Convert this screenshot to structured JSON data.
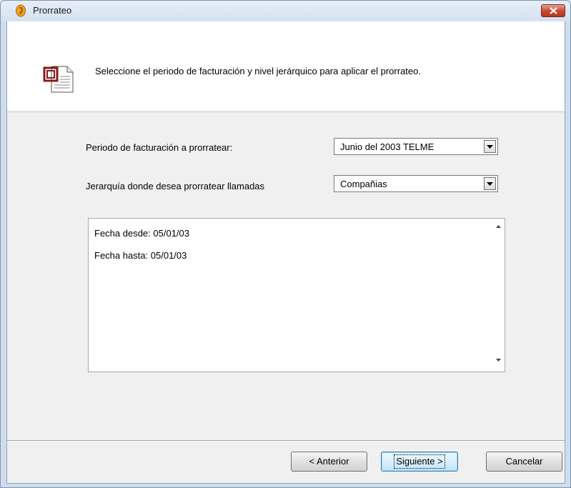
{
  "window": {
    "title": "Prorrateo",
    "app_icon": "ear-icon",
    "close_icon": "close-icon"
  },
  "header": {
    "icon": "document-icon",
    "instruction": "Seleccione el periodo de facturación y nivel jerárquico para aplicar el prorrateo."
  },
  "form": {
    "period_label": "Periodo de facturación a prorratear:",
    "period_value": "Junio del 2003 TELME",
    "hierarchy_label": "Jerarquía donde desea prorratear llamadas",
    "hierarchy_value": "Compañias"
  },
  "details": {
    "line1": "Fecha desde: 05/01/03",
    "line2": "Fecha hasta: 05/01/03"
  },
  "buttons": {
    "back": "< Anterior",
    "next": "Siguiente >",
    "cancel": "Cancelar"
  },
  "colors": {
    "close_button": "#c7472f",
    "window_border": "#7f95b3"
  }
}
